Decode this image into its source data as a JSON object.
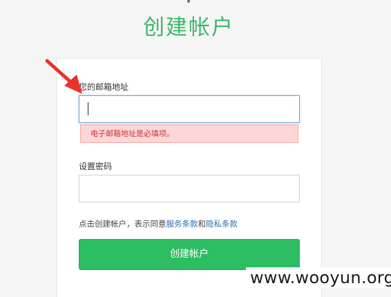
{
  "page": {
    "title": "创建帐户"
  },
  "form": {
    "email_label": "您的邮箱地址",
    "email_value": "",
    "email_error": "电子邮箱地址是必填项。",
    "password_label": "设置密码",
    "password_value": "",
    "terms": {
      "prefix": "点击创建帐户，表示同意",
      "service_link": "服务条款",
      "connector": "和",
      "privacy_link": "隐私条款"
    },
    "submit_label": "创建帐户"
  },
  "annotation": {
    "arrow_color": "#e8332a"
  },
  "watermark": {
    "text": "www.wooyun.org"
  },
  "colors": {
    "title": "#3cb76a",
    "button": "#2dbd62",
    "error_bg": "#fcd6d6",
    "error_text": "#c23a3a",
    "link": "#2f6fb5"
  }
}
